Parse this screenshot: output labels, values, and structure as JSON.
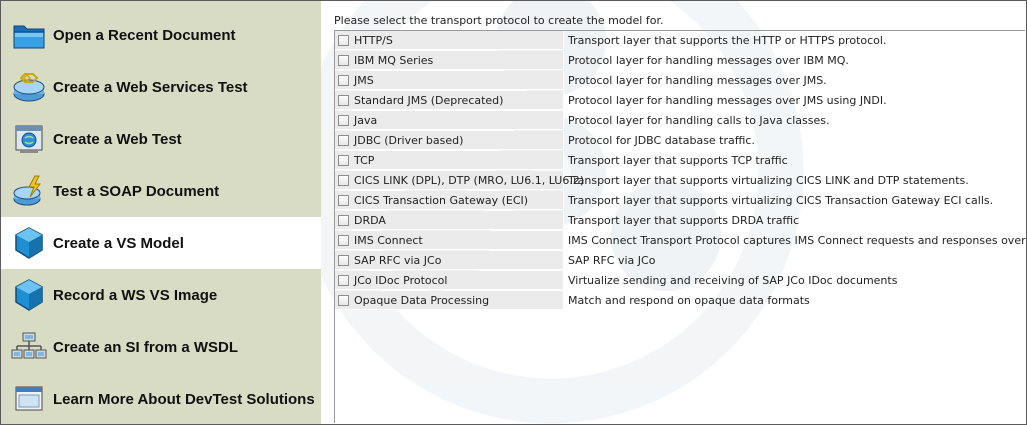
{
  "sidebar": {
    "items": [
      {
        "label": "Open a Recent Document",
        "icon": "folder-icon"
      },
      {
        "label": "Create a Web Services Test",
        "icon": "web-services-icon"
      },
      {
        "label": "Create a Web Test",
        "icon": "web-test-icon"
      },
      {
        "label": "Test a SOAP Document",
        "icon": "soap-document-icon"
      },
      {
        "label": "Create a VS Model",
        "icon": "vs-model-cube-icon",
        "active": true
      },
      {
        "label": "Record a WS VS Image",
        "icon": "vs-image-cube-icon"
      },
      {
        "label": "Create an SI from a WSDL",
        "icon": "wsdl-network-icon"
      },
      {
        "label": "Learn More About DevTest Solutions",
        "icon": "window-icon"
      }
    ]
  },
  "main": {
    "prompt": "Please select the transport protocol to create the model for.",
    "protocols": [
      {
        "name": "HTTP/S",
        "description": "Transport layer that supports the HTTP or HTTPS protocol."
      },
      {
        "name": "IBM MQ Series",
        "description": "Protocol layer for handling messages over IBM MQ."
      },
      {
        "name": "JMS",
        "description": "Protocol layer for handling messages over JMS."
      },
      {
        "name": "Standard JMS (Deprecated)",
        "description": "Protocol layer for handling messages over JMS using JNDI."
      },
      {
        "name": "Java",
        "description": "Protocol layer for handling calls to Java classes."
      },
      {
        "name": "JDBC (Driver based)",
        "description": "Protocol for JDBC database traffic."
      },
      {
        "name": "TCP",
        "description": "Transport layer that supports TCP traffic"
      },
      {
        "name": "CICS LINK (DPL), DTP (MRO, LU6.1, LU6.2)",
        "description": "Transport layer that supports virtualizing CICS LINK and DTP statements."
      },
      {
        "name": "CICS Transaction Gateway (ECI)",
        "description": "Transport layer that supports virtualizing CICS Transaction Gateway ECI calls."
      },
      {
        "name": "DRDA",
        "description": "Transport layer that supports DRDA traffic"
      },
      {
        "name": "IMS Connect",
        "description": "IMS Connect Transport Protocol captures IMS Connect requests and responses over TCP/IP"
      },
      {
        "name": "SAP RFC via JCo",
        "description": "SAP RFC via JCo"
      },
      {
        "name": "JCo IDoc Protocol",
        "description": "Virtualize sending and receiving of SAP JCo IDoc documents"
      },
      {
        "name": "Opaque Data Processing",
        "description": "Match and respond on opaque data formats"
      }
    ]
  },
  "colors": {
    "sidebar_bg": "#d9dcc4",
    "active_bg": "#ffffff",
    "protocol_cell_bg": "#ebebeb",
    "cube_blue": "#1f8fd1"
  }
}
